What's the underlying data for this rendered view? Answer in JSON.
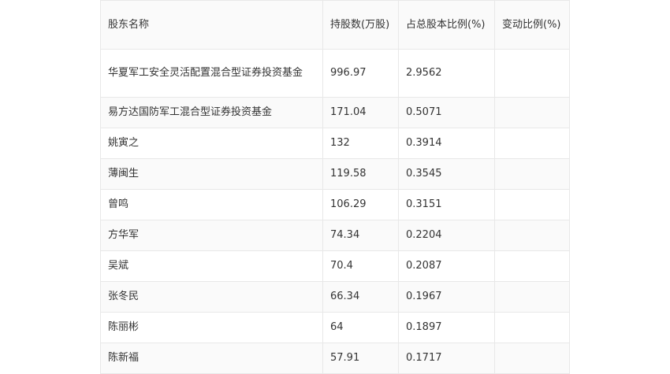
{
  "table": {
    "headers": [
      "股东名称",
      "持股数(万股)",
      "占总股本比例(%)",
      "变动比例(%)"
    ],
    "rows": [
      [
        "华夏军工安全灵活配置混合型证券投资基金",
        "996.97",
        "2.9562",
        ""
      ],
      [
        "易方达国防军工混合型证券投资基金",
        "171.04",
        "0.5071",
        ""
      ],
      [
        "姚寅之",
        "132",
        "0.3914",
        ""
      ],
      [
        "薄闽生",
        "119.58",
        "0.3545",
        ""
      ],
      [
        "曾鸣",
        "106.29",
        "0.3151",
        ""
      ],
      [
        "方华军",
        "74.34",
        "0.2204",
        ""
      ],
      [
        "吴斌",
        "70.4",
        "0.2087",
        ""
      ],
      [
        "张冬民",
        "66.34",
        "0.1967",
        ""
      ],
      [
        "陈丽彬",
        "64",
        "0.1897",
        ""
      ],
      [
        "陈新福",
        "57.91",
        "0.1717",
        ""
      ]
    ]
  }
}
